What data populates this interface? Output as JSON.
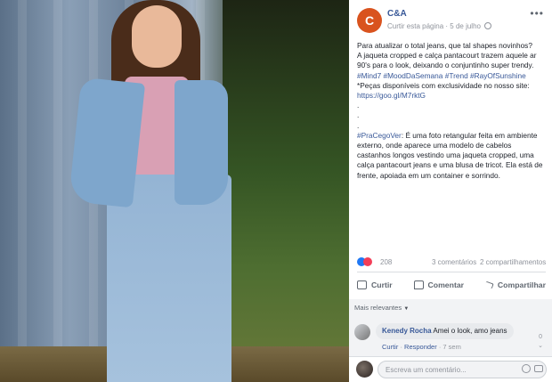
{
  "page": {
    "name": "C&A",
    "avatar_glyph": "C",
    "follow_label": "Curtir esta página",
    "date": "5 de julho",
    "brand_color": "#d9531e"
  },
  "post": {
    "line1": "Para atualizar o total jeans, que tal shapes novinhos?",
    "line2": "A jaqueta cropped e calça pantacourt trazem aquele ar 90's para o look, deixando o conjuntinho super trendy.",
    "hashtags": "#Mind7 #MoodDaSemana #Trend #RayOfSunshine",
    "availability": "*Peças disponíveis com exclusividade no nosso site:",
    "link": "https://goo.gl/M7rktG",
    "dot1": ".",
    "dot2": ".",
    "dot3": ".",
    "cegover_tag": "#PraCegoVer",
    "cegover_text": ": É uma foto retangular feita em ambiente externo, onde aparece uma modelo de cabelos castanhos longos vestindo uma jaqueta cropped, uma calça pantacourt jeans e uma blusa de tricot. Ela está de frente, apoiada em um container e sorrindo."
  },
  "stats": {
    "reactions": "208",
    "comments": "3 comentários",
    "shares": "2 compartilhamentos"
  },
  "actions": {
    "like": "Curtir",
    "comment": "Comentar",
    "share": "Compartilhar"
  },
  "comments": {
    "sort_label": "Mais relevantes",
    "items": [
      {
        "author": "Kenedy Rocha",
        "text": "Amei o look, amo jeans",
        "like": "Curtir",
        "reply": "Responder",
        "time": "7 sem",
        "score": "0"
      }
    ]
  },
  "composer": {
    "placeholder": "Escreva um comentário..."
  }
}
